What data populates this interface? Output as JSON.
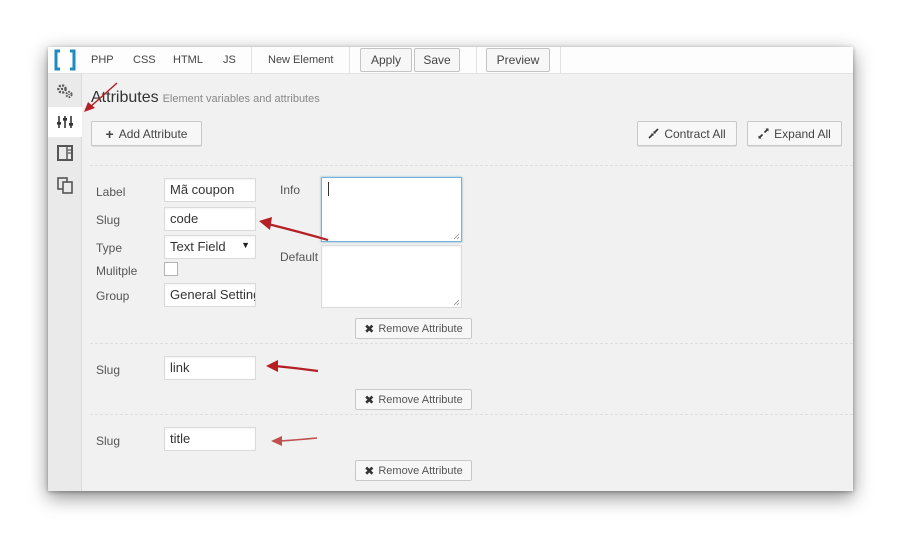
{
  "toolbar": {
    "tabs": [
      "PHP",
      "CSS",
      "HTML",
      "JS",
      "New Element"
    ],
    "apply_label": "Apply",
    "save_label": "Save",
    "preview_label": "Preview"
  },
  "sidebar": {
    "items": [
      {
        "icon": "gears-icon"
      },
      {
        "icon": "sliders-icon",
        "active": true
      },
      {
        "icon": "layout-icon"
      },
      {
        "icon": "copy-icon"
      }
    ]
  },
  "header": {
    "title": "Attributes",
    "subtitle": "Element variables and attributes"
  },
  "actions": {
    "add_label": "Add Attribute",
    "contract_label": "Contract All",
    "expand_label": "Expand All"
  },
  "attributes": [
    {
      "label_label": "Label",
      "label_value": "Mã coupon",
      "slug_label": "Slug",
      "slug_value": "code",
      "type_label": "Type",
      "type_value": "Text Field",
      "multiple_label": "Mulitple",
      "group_label": "Group",
      "group_value": "General Settings",
      "info_label": "Info",
      "default_label": "Default",
      "remove_label": "Remove Attribute"
    },
    {
      "slug_label": "Slug",
      "slug_value": "link",
      "remove_label": "Remove Attribute"
    },
    {
      "slug_label": "Slug",
      "slug_value": "title",
      "remove_label": "Remove Attribute"
    }
  ],
  "colors": {
    "accent": "#1e8cbe",
    "annotation_arrow": "#b52025",
    "background": "#f1f1f1"
  }
}
